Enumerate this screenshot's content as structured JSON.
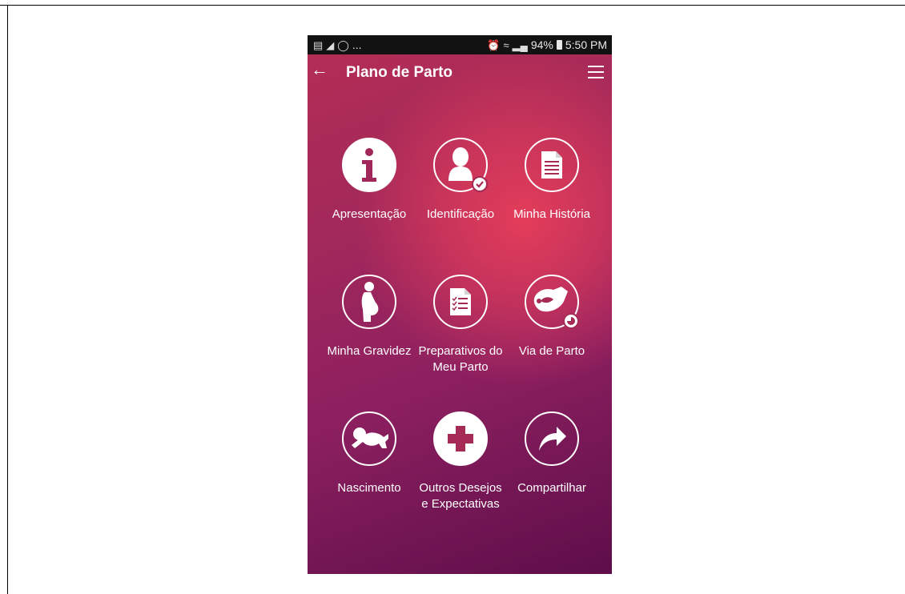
{
  "status_bar": {
    "left_icons": [
      "image-icon",
      "flipboard-icon",
      "whatsapp-icon"
    ],
    "ellipsis": "...",
    "battery_percent": "94%",
    "time": "5:50 PM"
  },
  "app_bar": {
    "title": "Plano de Parto"
  },
  "menu_items": [
    {
      "label": "Apresentação",
      "icon": "info-icon"
    },
    {
      "label": "Identificação",
      "icon": "user-check-icon"
    },
    {
      "label": "Minha História",
      "icon": "document-icon"
    },
    {
      "label": "Minha Gravidez",
      "icon": "pregnant-woman-icon"
    },
    {
      "label": "Preparativos do Meu Parto",
      "icon": "checklist-icon"
    },
    {
      "label": "Via de Parto",
      "icon": "birth-position-icon"
    },
    {
      "label": "Nascimento",
      "icon": "baby-icon"
    },
    {
      "label": "Outros Desejos e Expectativas",
      "icon": "plus-icon"
    },
    {
      "label": "Compartilhar",
      "icon": "share-arrow-icon"
    }
  ],
  "colors": {
    "accent_pink": "#e83e5a",
    "deep_plum": "#5e0e4a",
    "status_bar": "#121212"
  }
}
